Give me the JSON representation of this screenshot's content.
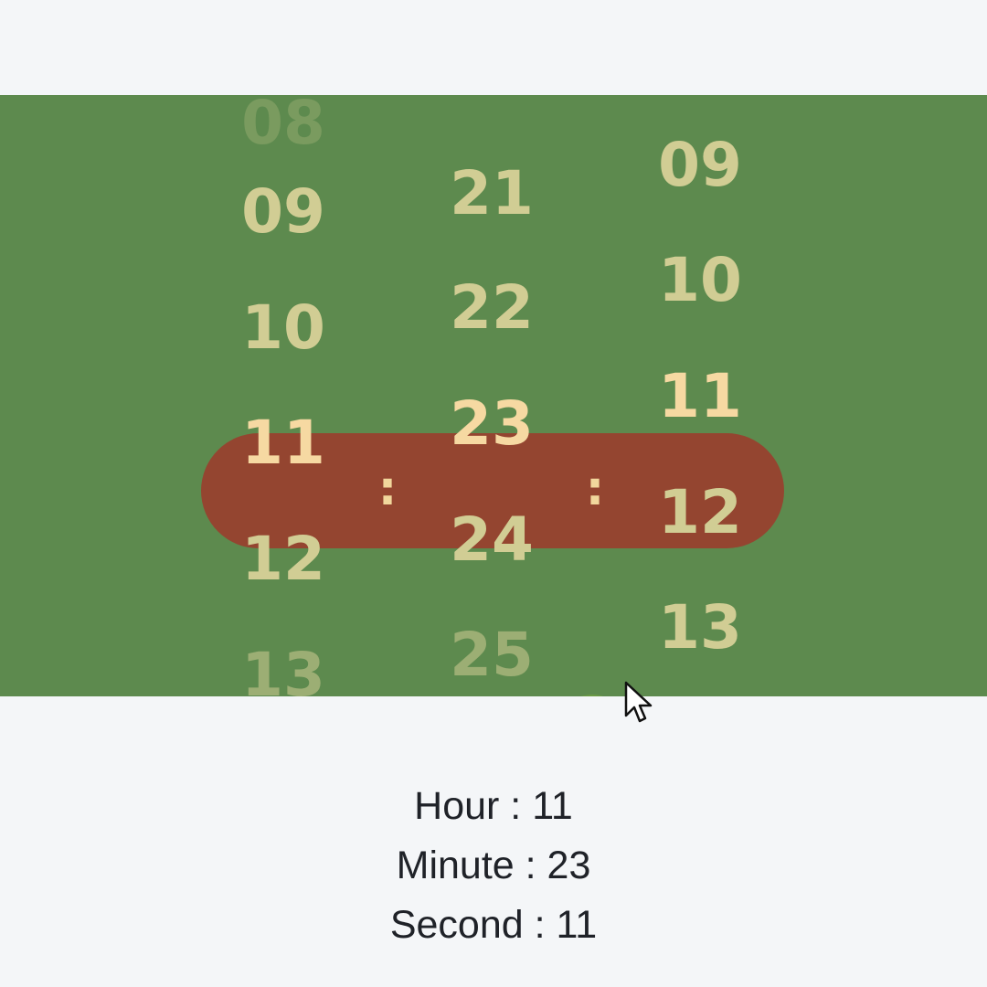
{
  "picker": {
    "separators": [
      ":",
      ":"
    ],
    "hour_column": {
      "items": [
        "08",
        "09",
        "10",
        "11",
        "12",
        "13"
      ],
      "selected": "11"
    },
    "minute_column": {
      "items": [
        "21",
        "22",
        "23",
        "24",
        "25"
      ],
      "selected": "23"
    },
    "second_column": {
      "items": [
        "09",
        "10",
        "11",
        "12",
        "13"
      ],
      "selected": "11"
    }
  },
  "readout": {
    "hour": "Hour : 11",
    "minute": "Minute : 23",
    "second": "Second : 11"
  },
  "colors": {
    "background": "#f4f6f8",
    "picker_background": "#5d8a4e",
    "selection_pill": "#944530",
    "unselected_text": "#d1cd94",
    "selected_text": "#f6d9a2"
  }
}
